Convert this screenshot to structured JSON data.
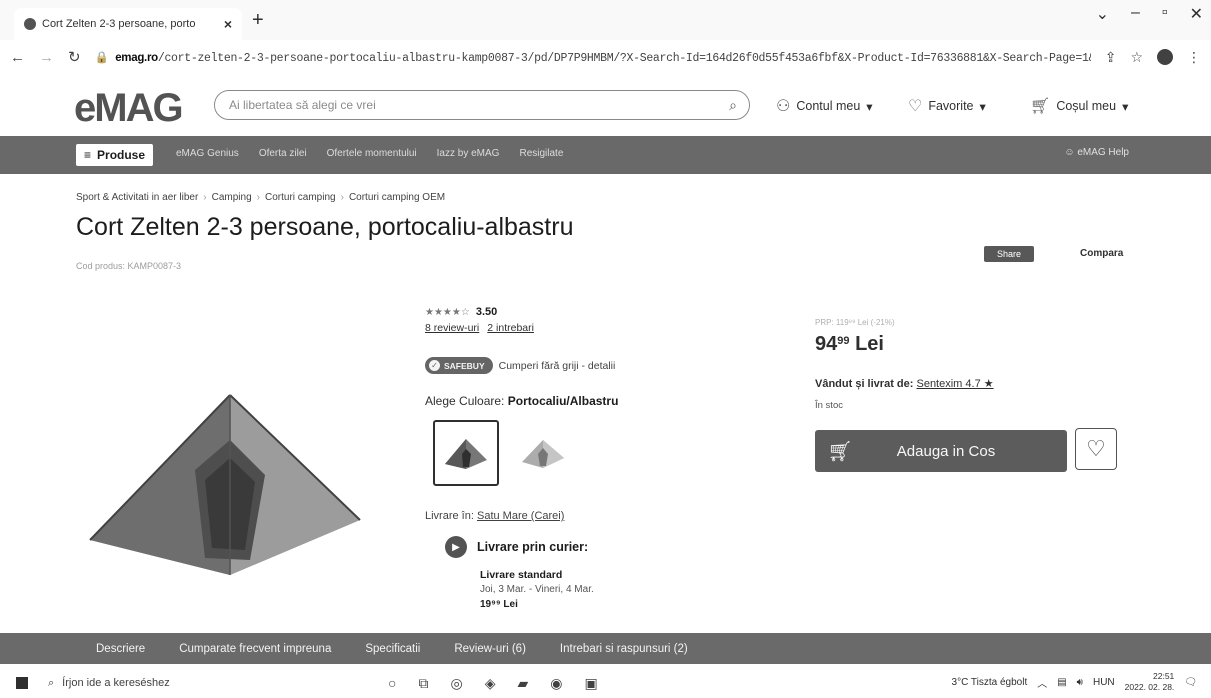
{
  "browser": {
    "tab_title": "Cort Zelten 2-3 persoane, porto",
    "url_domain": "emag.ro",
    "url_path": "/cort-zelten-2-3-persoane-portocaliu-albastru-kamp0087-3/pd/DP7P9HMBM/?X-Search-Id=164d26f0d55f453a6fbf&X-Product-Id=76336881&X-Search-Page=1&X-..."
  },
  "header": {
    "logo": "eMAG",
    "search_placeholder": "Ai libertatea să alegi ce vrei",
    "account": "Contul meu",
    "favorites": "Favorite",
    "cart": "Coșul meu"
  },
  "nav": {
    "produse": "Produse",
    "links": [
      "eMAG Genius",
      "Oferta zilei",
      "Ofertele momentului",
      "Iazz by eMAG",
      "Resigilate"
    ],
    "help": "eMAG Help"
  },
  "breadcrumb": [
    "Sport & Activitati in aer liber",
    "Camping",
    "Corturi camping",
    "Corturi camping OEM"
  ],
  "product": {
    "title": "Cort Zelten 2-3 persoane, portocaliu-albastru",
    "code": "Cod produs: KAMP0087-3",
    "share": "Share",
    "compare": "Compara",
    "rating": "3.50",
    "reviews": "8 review-uri",
    "questions": "2 intrebari",
    "safebuy_badge": "SAFEBUY",
    "safebuy_text": "Cumperi fără griji - detalii",
    "color_label": "Alege Culoare:",
    "color_value": "Portocaliu/Albastru",
    "delivery_to_label": "Livrare în:",
    "delivery_to_value": "Satu Mare (Carei)",
    "courier": "Livrare prin curier:",
    "standard": "Livrare standard",
    "standard_dates": "Joi, 3 Mar. - Vineri, 4 Mar.",
    "standard_price": "19⁹⁹ Lei"
  },
  "buy": {
    "old_price": "PRP: 119⁹⁹ Lei (-21%)",
    "price_int": "94",
    "price_dec": "99",
    "currency": "Lei",
    "sold_by_label": "Vândut și livrat de:",
    "seller": "Sentexim 4.7 ★",
    "stock": "În stoc",
    "add_to_cart": "Adauga in Cos"
  },
  "bottom_tabs": [
    "Descriere",
    "Cumparate frecvent impreuna",
    "Specificatii",
    "Review-uri (6)",
    "Intrebari si raspunsuri (2)"
  ],
  "taskbar": {
    "search": "Írjon ide a kereséshez",
    "weather": "3°C  Tiszta égbolt",
    "lang": "HUN",
    "time": "22:51",
    "date": "2022. 02. 28."
  }
}
